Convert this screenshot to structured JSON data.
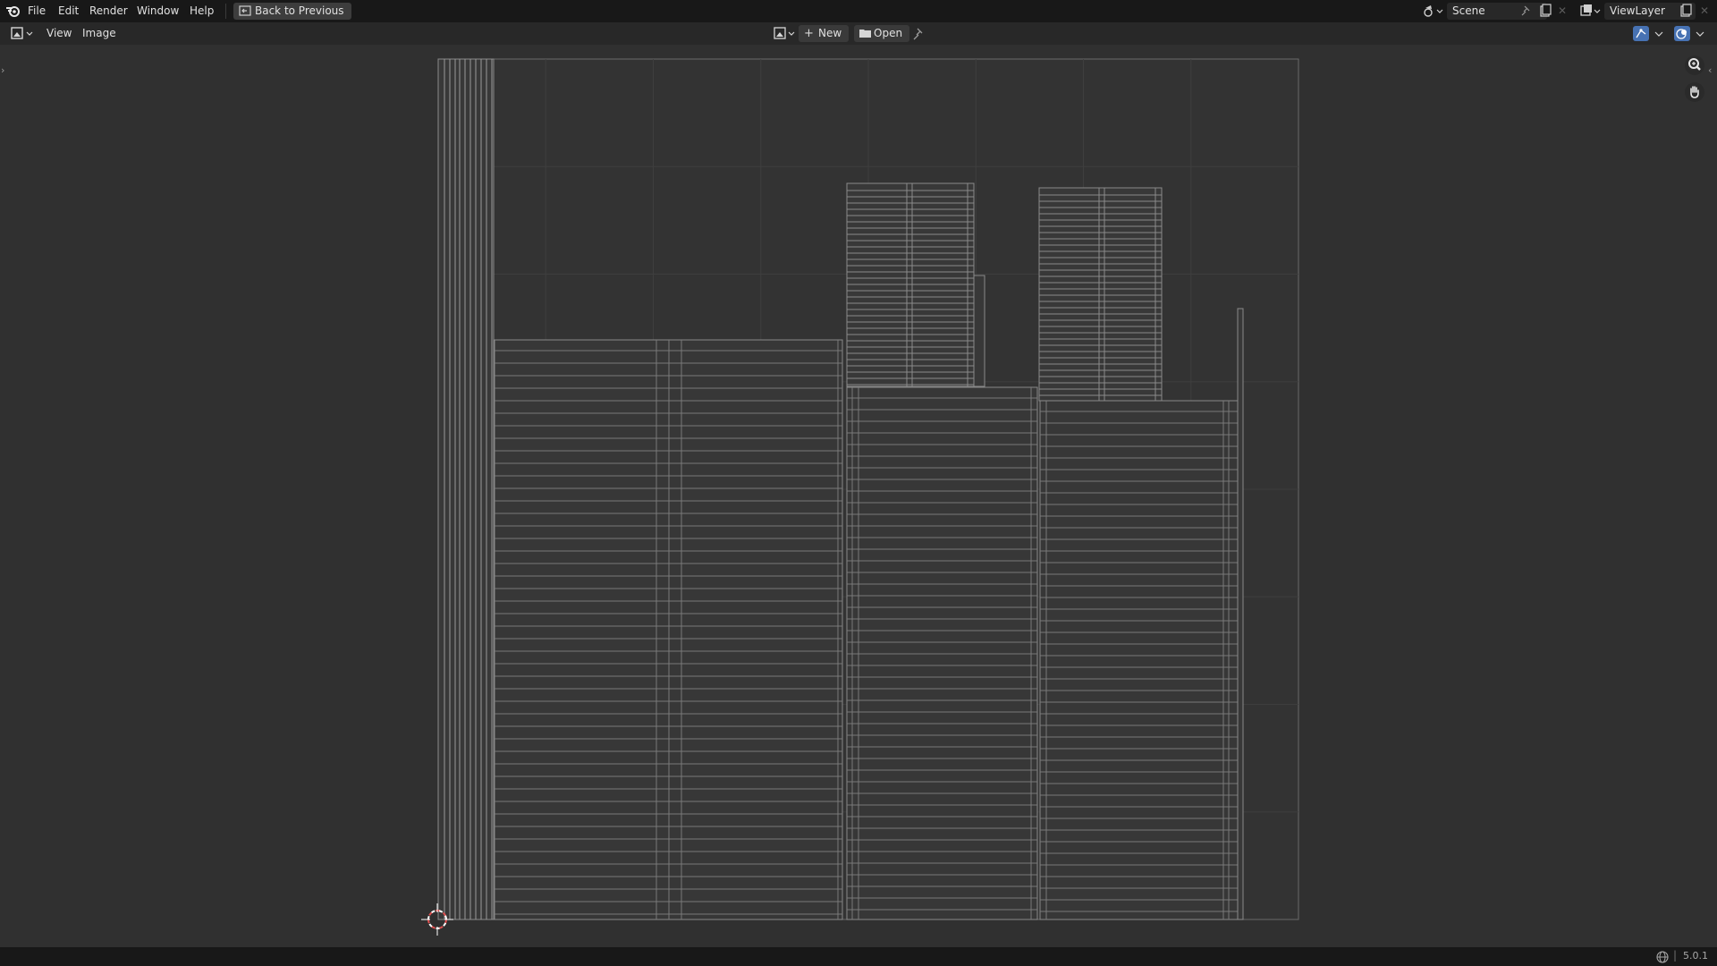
{
  "topbar": {
    "menus": [
      "File",
      "Edit",
      "Render",
      "Window",
      "Help"
    ],
    "back_label": "Back to Previous",
    "scene_name": "Scene",
    "view_layer_name": "ViewLayer"
  },
  "header": {
    "view_label": "View",
    "image_label": "Image",
    "new_label": "New",
    "open_label": "Open"
  },
  "statusbar": {
    "version": "5.0.1"
  },
  "icons": {
    "logo": "blender-logo-icon",
    "editor_type": "image-editor-icon",
    "image_browse": "image-browse-icon",
    "pin": "pin-icon",
    "zoom": "zoom-icon",
    "pan": "hand-icon",
    "gizmo": "gizmo-icon",
    "overlay": "overlay-icon",
    "cursor": "2d-cursor-icon",
    "network": "network-icon"
  },
  "colors": {
    "topbar_bg": "#181818",
    "header_bg": "#282828",
    "viewport_bg": "#303030",
    "mesh_wire": "#8a8a8a",
    "grid_line": "#3c3c3c",
    "accent_blue": "#4772b3"
  }
}
